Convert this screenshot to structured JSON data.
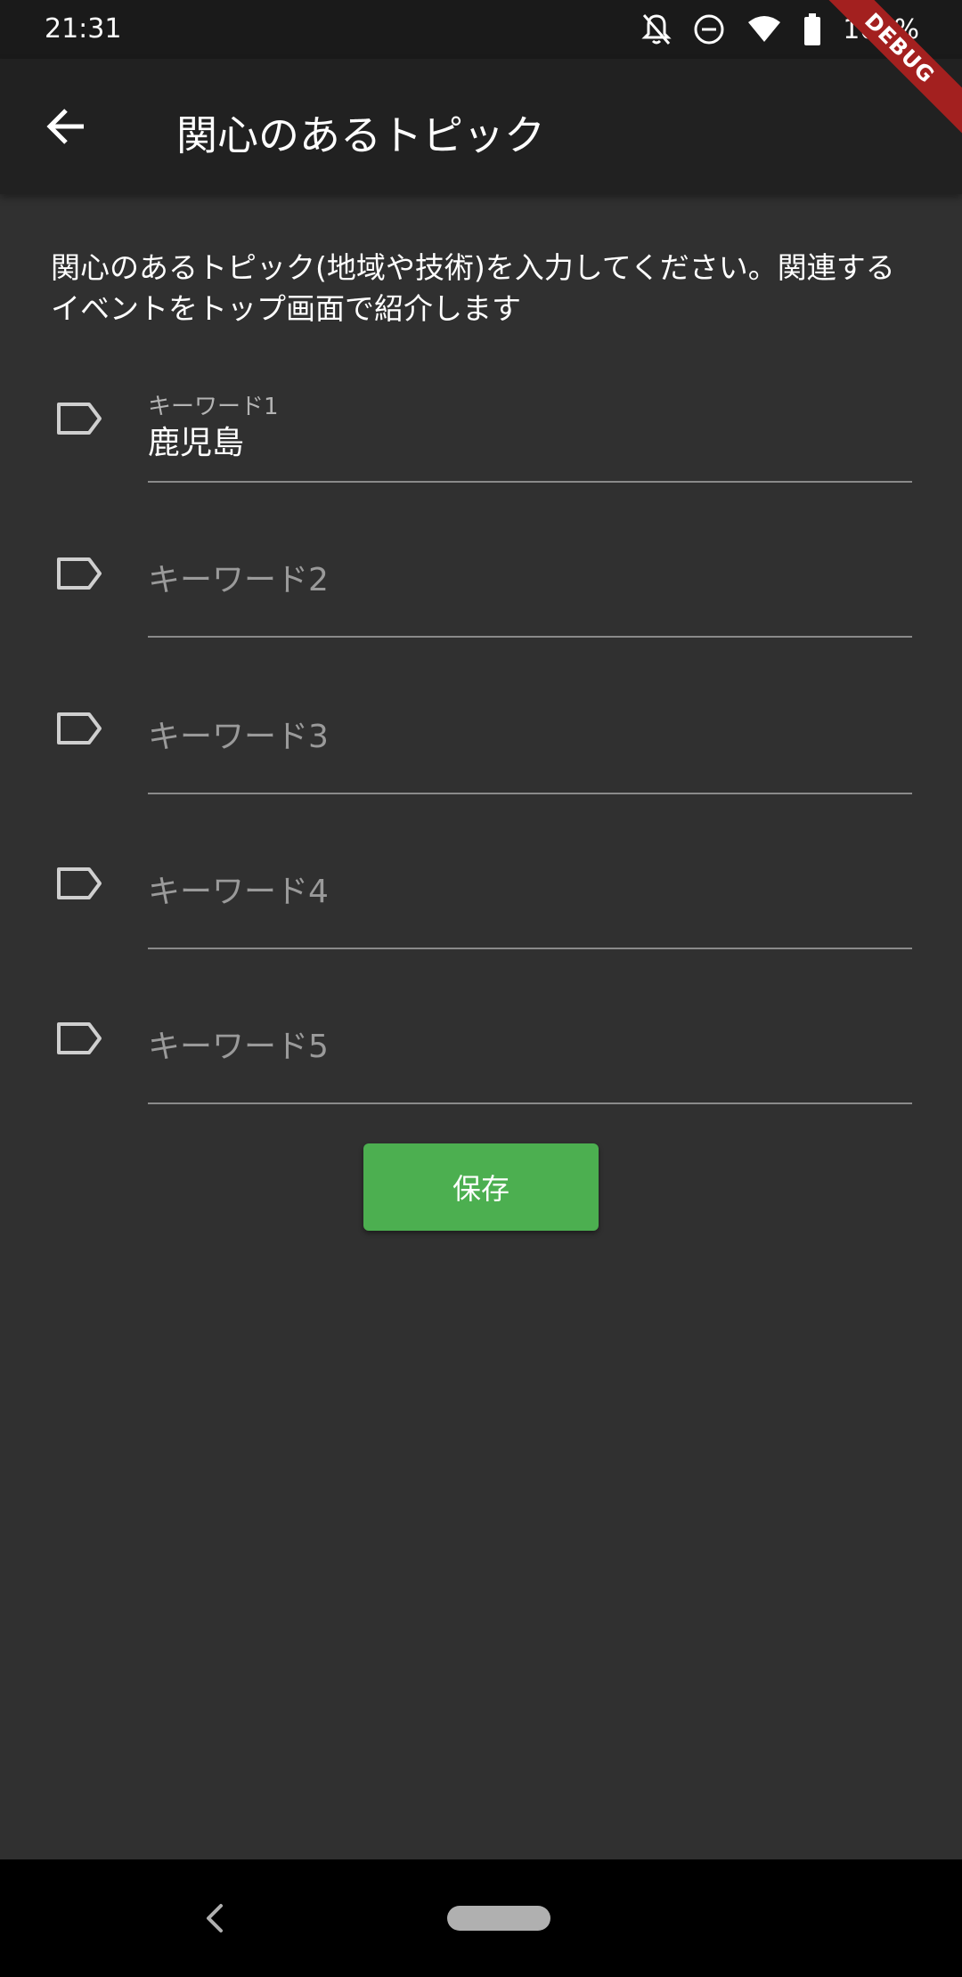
{
  "status_bar": {
    "time": "21:31",
    "battery": "100%",
    "icons": [
      "notifications-off-icon",
      "do-not-disturb-icon",
      "wifi-icon",
      "battery-icon"
    ]
  },
  "debug_banner": "DEBUG",
  "app_bar": {
    "back_icon": "arrow-back-icon",
    "title": "関心のあるトピック"
  },
  "description": "関心のあるトピック(地域や技術)を入力してください。関連するイベントをトップ画面で紹介します",
  "fields": [
    {
      "label": "キーワード1",
      "value": "鹿児島"
    },
    {
      "label": "キーワード2",
      "value": ""
    },
    {
      "label": "キーワード3",
      "value": ""
    },
    {
      "label": "キーワード4",
      "value": ""
    },
    {
      "label": "キーワード5",
      "value": ""
    }
  ],
  "save_button": {
    "label": "保存"
  },
  "colors": {
    "background": "#303030",
    "app_bar": "#212121",
    "accent": "#4caf50",
    "debug": "#a3201f"
  }
}
